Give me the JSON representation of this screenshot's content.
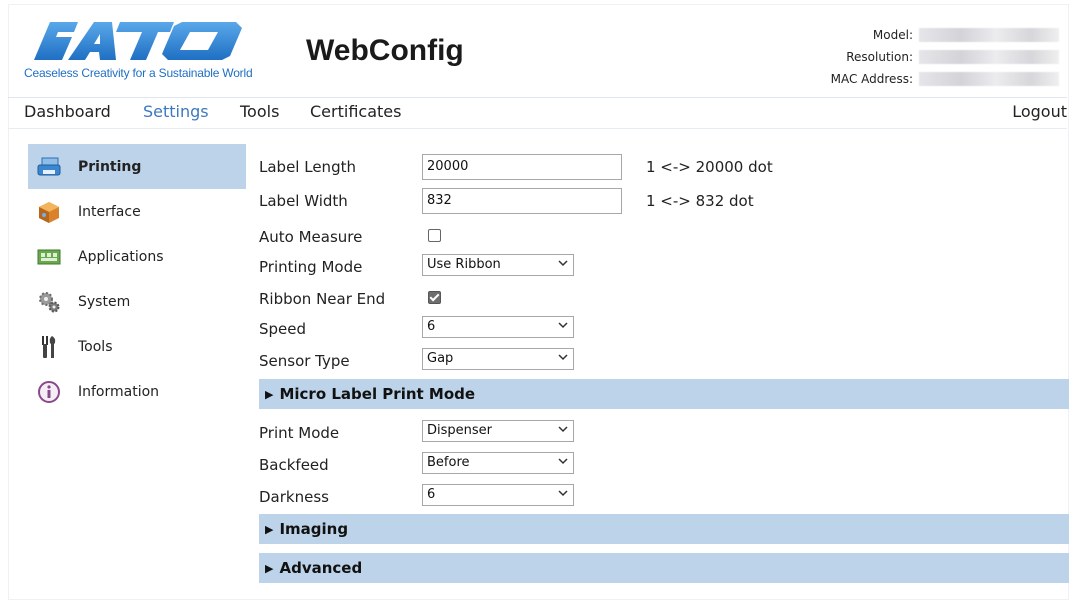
{
  "brand": {
    "logo_text": "SATO",
    "tagline": "Ceaseless Creativity for a Sustainable World",
    "app_title": "WebConfig",
    "logo_color": "#1f6fc4"
  },
  "device_info": {
    "model_label": "Model:",
    "resolution_label": "Resolution:",
    "mac_label": "MAC Address:"
  },
  "topnav": {
    "items": [
      "Dashboard",
      "Settings",
      "Tools",
      "Certificates"
    ],
    "active": "Settings",
    "logout": "Logout"
  },
  "sidebar": {
    "items": [
      {
        "label": "Printing",
        "icon": "printer-icon"
      },
      {
        "label": "Interface",
        "icon": "interface-box-icon"
      },
      {
        "label": "Applications",
        "icon": "applications-icon"
      },
      {
        "label": "System",
        "icon": "gears-icon"
      },
      {
        "label": "Tools",
        "icon": "tools-icon"
      },
      {
        "label": "Information",
        "icon": "info-icon"
      }
    ],
    "active": "Printing",
    "active_color": "#bcd3ea"
  },
  "form": {
    "label_length": {
      "label": "Label Length",
      "value": "20000",
      "hint": "1 <-> 20000 dot"
    },
    "label_width": {
      "label": "Label Width",
      "value": "832",
      "hint": "1 <-> 832 dot"
    },
    "auto_measure": {
      "label": "Auto Measure",
      "checked": false
    },
    "printing_mode": {
      "label": "Printing Mode",
      "value": "Use Ribbon"
    },
    "ribbon_near_end": {
      "label": "Ribbon Near End",
      "checked": true
    },
    "speed": {
      "label": "Speed",
      "value": "6"
    },
    "sensor_type": {
      "label": "Sensor Type",
      "value": "Gap"
    }
  },
  "sections": {
    "micro_label": "Micro Label Print Mode",
    "imaging": "Imaging",
    "advanced": "Advanced"
  },
  "micro_form": {
    "print_mode": {
      "label": "Print Mode",
      "value": "Dispenser"
    },
    "backfeed": {
      "label": "Backfeed",
      "value": "Before"
    },
    "darkness": {
      "label": "Darkness",
      "value": "6"
    }
  }
}
